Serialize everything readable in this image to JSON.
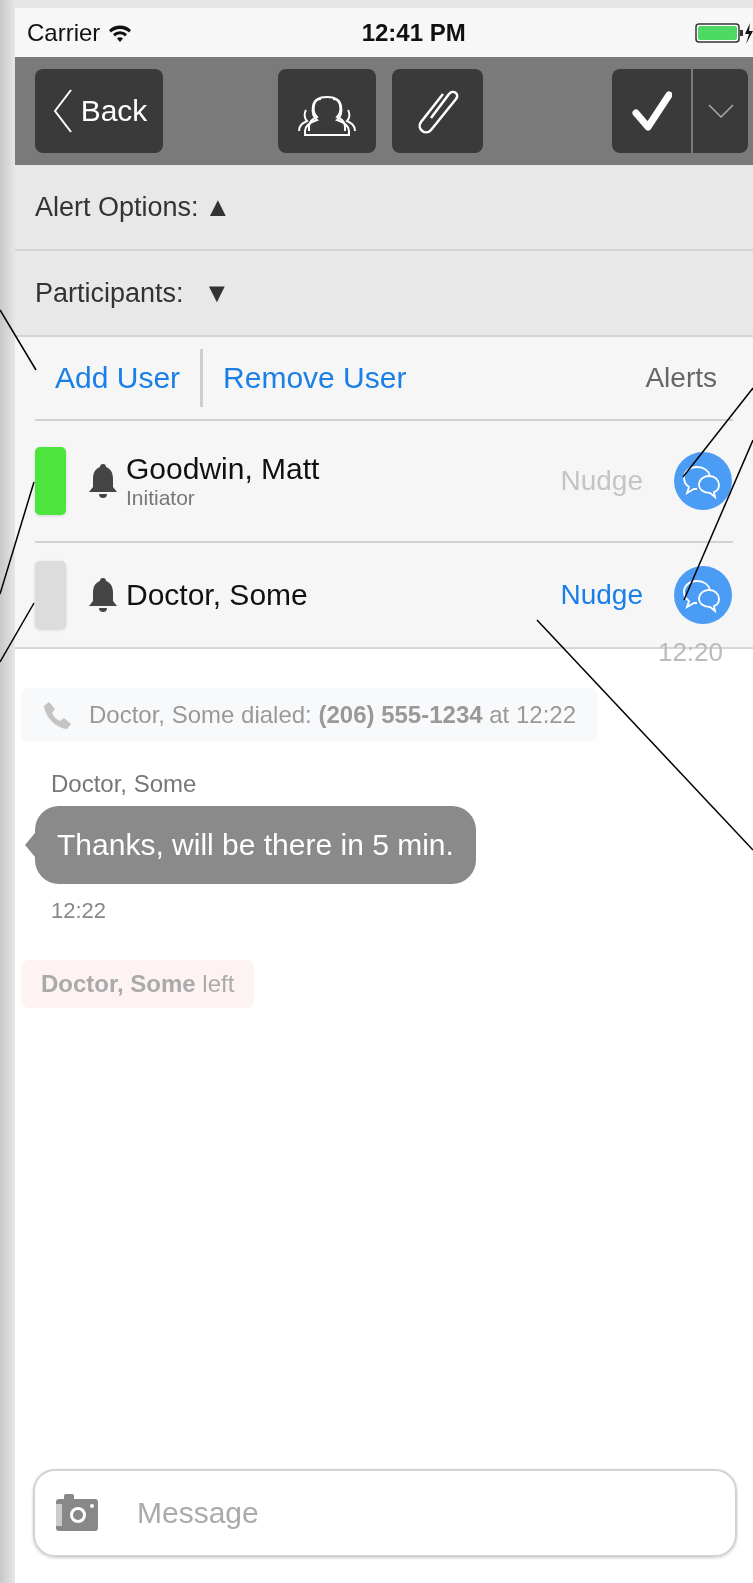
{
  "status_bar": {
    "carrier": "Carrier",
    "time": "12:41 PM"
  },
  "nav": {
    "back": "Back",
    "tools": [
      {
        "kind": "participants"
      },
      {
        "kind": "attachment"
      }
    ],
    "confirm": {
      "kind": "check"
    }
  },
  "sections": [
    {
      "label": "Alert Options:",
      "arrow": "▲",
      "expanded": false
    },
    {
      "label": "Participants:",
      "arrow": "▼",
      "expanded": true
    }
  ],
  "participants": {
    "actions": [
      "Add User",
      "Remove User"
    ],
    "alerts_heading": "Alerts",
    "rows": [
      {
        "name": "Goodwin, Matt",
        "role": "Initiator",
        "color": "#4ee43e",
        "nudge": "Nudge",
        "nudge_disabled": true
      },
      {
        "name": "Doctor, Some",
        "color": "#dcdcdc",
        "nudge": "Nudge",
        "nudge_disabled": false
      }
    ]
  },
  "background_time": "12:20",
  "messages": [
    {
      "kind": "call",
      "text": "Doctor, Some dialed: **(206) 555-1234** at 12:22"
    },
    {
      "kind": "bubble",
      "sender": "Doctor, Some",
      "text": "Thanks, will be there in 5 min.",
      "time": "12:22"
    },
    {
      "kind": "left",
      "text": "**Doctor, Some** left"
    }
  ],
  "composer": {
    "placeholder": "Message"
  }
}
